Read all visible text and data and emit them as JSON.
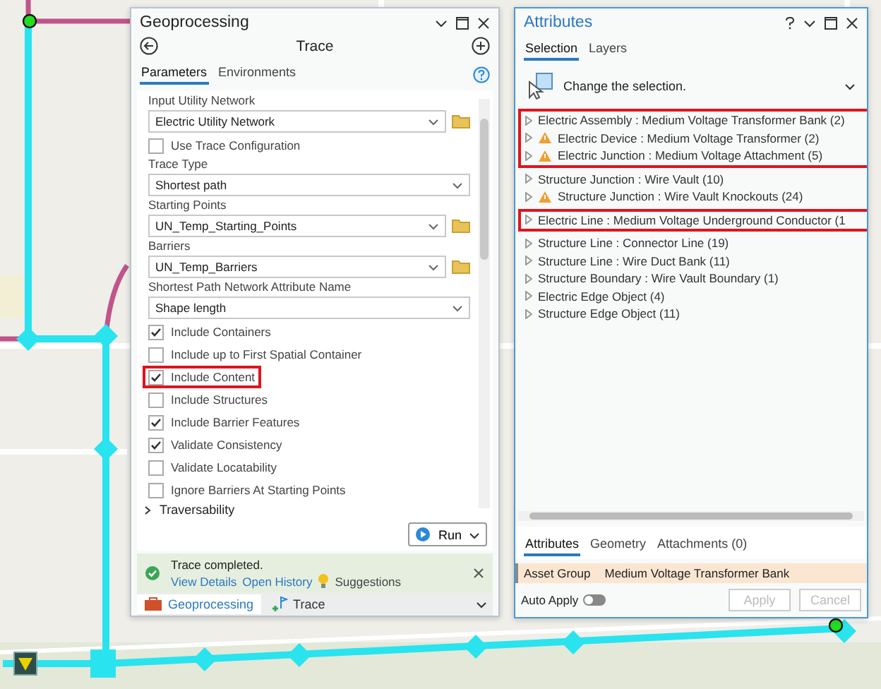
{
  "geoprocessing": {
    "title": "Geoprocessing",
    "tool_title": "Trace",
    "tabs": [
      {
        "label": "Parameters",
        "selected": true
      },
      {
        "label": "Environments",
        "selected": false
      }
    ],
    "parameters": [
      {
        "kind": "dropdown",
        "label": "Input Utility Network",
        "value": "Electric Utility Network",
        "browse": true
      },
      {
        "kind": "checkbox",
        "label": "Use Trace Configuration",
        "checked": false,
        "highlighted": false
      },
      {
        "kind": "dropdown",
        "label": "Trace Type",
        "value": "Shortest path",
        "browse": false
      },
      {
        "kind": "dropdown",
        "label": "Starting Points",
        "value": "UN_Temp_Starting_Points",
        "browse": true
      },
      {
        "kind": "dropdown",
        "label": "Barriers",
        "value": "UN_Temp_Barriers",
        "browse": true
      },
      {
        "kind": "dropdown",
        "label": "Shortest Path Network Attribute Name",
        "value": "Shape length",
        "browse": false
      },
      {
        "kind": "checkbox",
        "label": "Include Containers",
        "checked": true,
        "highlighted": false
      },
      {
        "kind": "checkbox",
        "label": "Include up to First Spatial Container",
        "checked": false,
        "highlighted": false
      },
      {
        "kind": "checkbox",
        "label": "Include Content",
        "checked": true,
        "highlighted": true
      },
      {
        "kind": "checkbox",
        "label": "Include Structures",
        "checked": false,
        "highlighted": false
      },
      {
        "kind": "checkbox",
        "label": "Include Barrier Features",
        "checked": true,
        "highlighted": false
      },
      {
        "kind": "checkbox",
        "label": "Validate Consistency",
        "checked": true,
        "highlighted": false
      },
      {
        "kind": "checkbox",
        "label": "Validate Locatability",
        "checked": false,
        "highlighted": false
      },
      {
        "kind": "checkbox",
        "label": "Ignore Barriers At Starting Points",
        "checked": false,
        "highlighted": false
      },
      {
        "kind": "section",
        "label": "Traversability",
        "expanded": false
      }
    ],
    "run_button": "Run",
    "message": {
      "text": "Trace completed.",
      "links": [
        "View Details",
        "Open History",
        "Suggestions"
      ]
    },
    "bottom_tabs": [
      {
        "label": "Geoprocessing",
        "selected": true
      },
      {
        "label": "Trace",
        "selected": false
      }
    ]
  },
  "attributes": {
    "title": "Attributes",
    "tabs": [
      {
        "label": "Selection",
        "selected": true
      },
      {
        "label": "Layers",
        "selected": false
      }
    ],
    "change_selection": "Change the selection.",
    "tree": [
      {
        "label": "Electric Assembly : Medium Voltage Transformer Bank (2)",
        "warning": false,
        "highlighted": true
      },
      {
        "label": "Electric Device : Medium Voltage Transformer (2)",
        "warning": true,
        "highlighted": true
      },
      {
        "label": "Electric Junction : Medium Voltage Attachment (5)",
        "warning": true,
        "highlighted": true
      },
      {
        "label": "Structure Junction : Wire Vault (10)",
        "warning": false,
        "highlighted": false
      },
      {
        "label": "Structure Junction : Wire Vault Knockouts (24)",
        "warning": true,
        "highlighted": false
      },
      {
        "label": "Electric Line : Medium Voltage Underground Conductor (1",
        "warning": false,
        "highlighted": true
      },
      {
        "label": "Structure Line : Connector Line (19)",
        "warning": false,
        "highlighted": false
      },
      {
        "label": "Structure Line : Wire Duct Bank (11)",
        "warning": false,
        "highlighted": false
      },
      {
        "label": "Structure Boundary : Wire Vault Boundary (1)",
        "warning": false,
        "highlighted": false
      },
      {
        "label": "Electric Edge Object (4)",
        "warning": false,
        "highlighted": false
      },
      {
        "label": "Structure Edge Object (11)",
        "warning": false,
        "highlighted": false
      }
    ],
    "detail_tabs": [
      {
        "label": "Attributes",
        "selected": true
      },
      {
        "label": "Geometry",
        "selected": false
      },
      {
        "label": "Attachments (0)",
        "selected": false
      }
    ],
    "field": {
      "name": "Asset Group",
      "value": "Medium Voltage Transformer Bank"
    },
    "auto_apply": {
      "label": "Auto Apply",
      "on": false
    },
    "buttons": [
      {
        "label": "Apply",
        "disabled": true
      },
      {
        "label": "Cancel",
        "disabled": true
      }
    ]
  }
}
